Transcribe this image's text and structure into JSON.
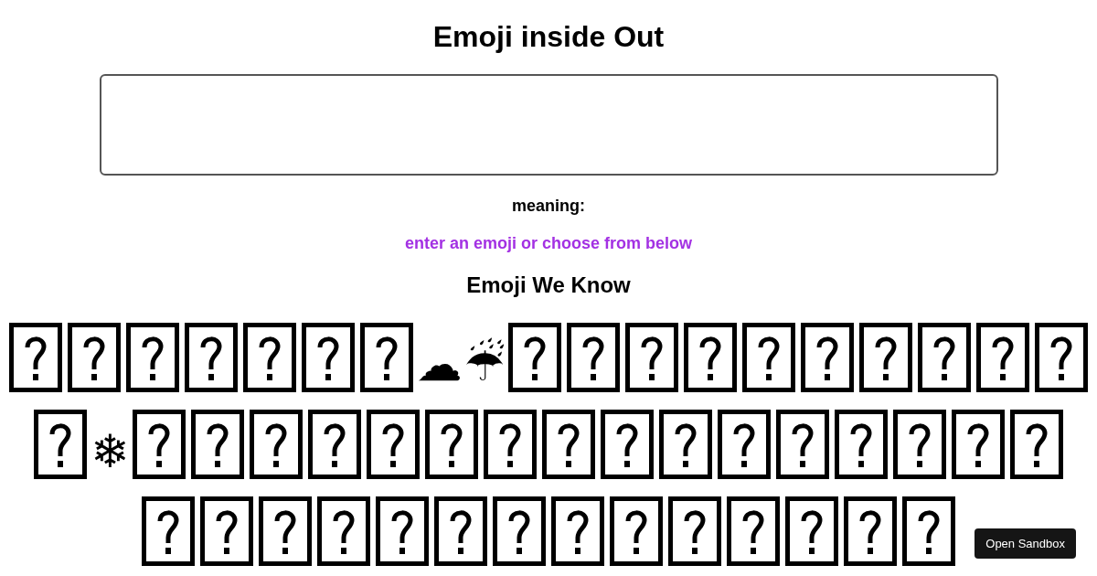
{
  "title": "Emoji inside Out",
  "meaning_label": "meaning:",
  "meaning": "enter an emoji or choose from below",
  "list_heading": "Emoji We Know",
  "emojis": [
    {
      "kind": "missing"
    },
    {
      "kind": "missing"
    },
    {
      "kind": "missing"
    },
    {
      "kind": "missing"
    },
    {
      "kind": "missing"
    },
    {
      "kind": "missing"
    },
    {
      "kind": "missing"
    },
    {
      "kind": "glyph",
      "char": "☁"
    },
    {
      "kind": "glyph",
      "char": "☔"
    },
    {
      "kind": "missing"
    },
    {
      "kind": "missing"
    },
    {
      "kind": "missing"
    },
    {
      "kind": "missing"
    },
    {
      "kind": "missing"
    },
    {
      "kind": "missing"
    },
    {
      "kind": "missing"
    },
    {
      "kind": "missing"
    },
    {
      "kind": "missing"
    },
    {
      "kind": "missing"
    },
    {
      "kind": "missing"
    },
    {
      "kind": "glyph",
      "char": "❄"
    },
    {
      "kind": "missing"
    },
    {
      "kind": "missing"
    },
    {
      "kind": "missing"
    },
    {
      "kind": "missing"
    },
    {
      "kind": "missing"
    },
    {
      "kind": "missing"
    },
    {
      "kind": "missing"
    },
    {
      "kind": "missing"
    },
    {
      "kind": "missing"
    },
    {
      "kind": "missing"
    },
    {
      "kind": "missing"
    },
    {
      "kind": "missing"
    },
    {
      "kind": "missing"
    },
    {
      "kind": "missing"
    },
    {
      "kind": "missing"
    },
    {
      "kind": "missing"
    },
    {
      "kind": "missing"
    },
    {
      "kind": "missing"
    },
    {
      "kind": "missing"
    },
    {
      "kind": "missing"
    },
    {
      "kind": "missing"
    },
    {
      "kind": "missing"
    },
    {
      "kind": "missing"
    },
    {
      "kind": "missing"
    },
    {
      "kind": "missing"
    },
    {
      "kind": "missing"
    },
    {
      "kind": "missing"
    },
    {
      "kind": "missing"
    },
    {
      "kind": "missing"
    },
    {
      "kind": "missing"
    }
  ],
  "sandbox_button": "Open Sandbox"
}
